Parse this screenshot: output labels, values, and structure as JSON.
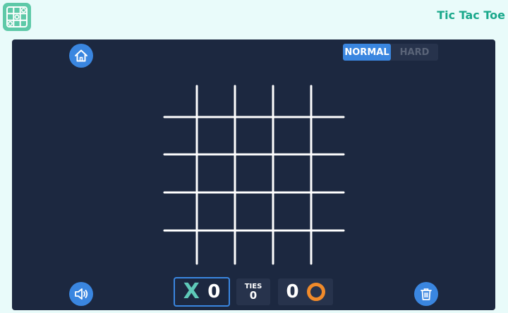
{
  "app": {
    "title": "Tic Tac Toe",
    "logo_icon": "grid-logo-icon"
  },
  "mode": {
    "normal_label": "NORMAL",
    "hard_label": "HARD",
    "selected": "NORMAL"
  },
  "controls": {
    "home_icon": "home-icon",
    "sound_icon": "speaker-icon",
    "reset_icon": "trash-icon"
  },
  "board": {
    "size": 5,
    "cells": [
      "",
      "",
      "",
      "",
      "",
      "",
      "",
      "",
      "",
      "",
      "",
      "",
      "",
      "",
      "",
      "",
      "",
      "",
      "",
      "",
      "",
      "",
      "",
      "",
      ""
    ]
  },
  "score": {
    "x_label": "X",
    "x_score": "0",
    "ties_label": "TIES",
    "ties_score": "0",
    "o_score": "0",
    "active_player": "X"
  },
  "colors": {
    "background": "#e9fbfa",
    "panel": "#1c2840",
    "accent": "#3a86e0",
    "x_color": "#5ec9b8",
    "o_color": "#f08a2a",
    "title_color": "#1aa88b"
  }
}
